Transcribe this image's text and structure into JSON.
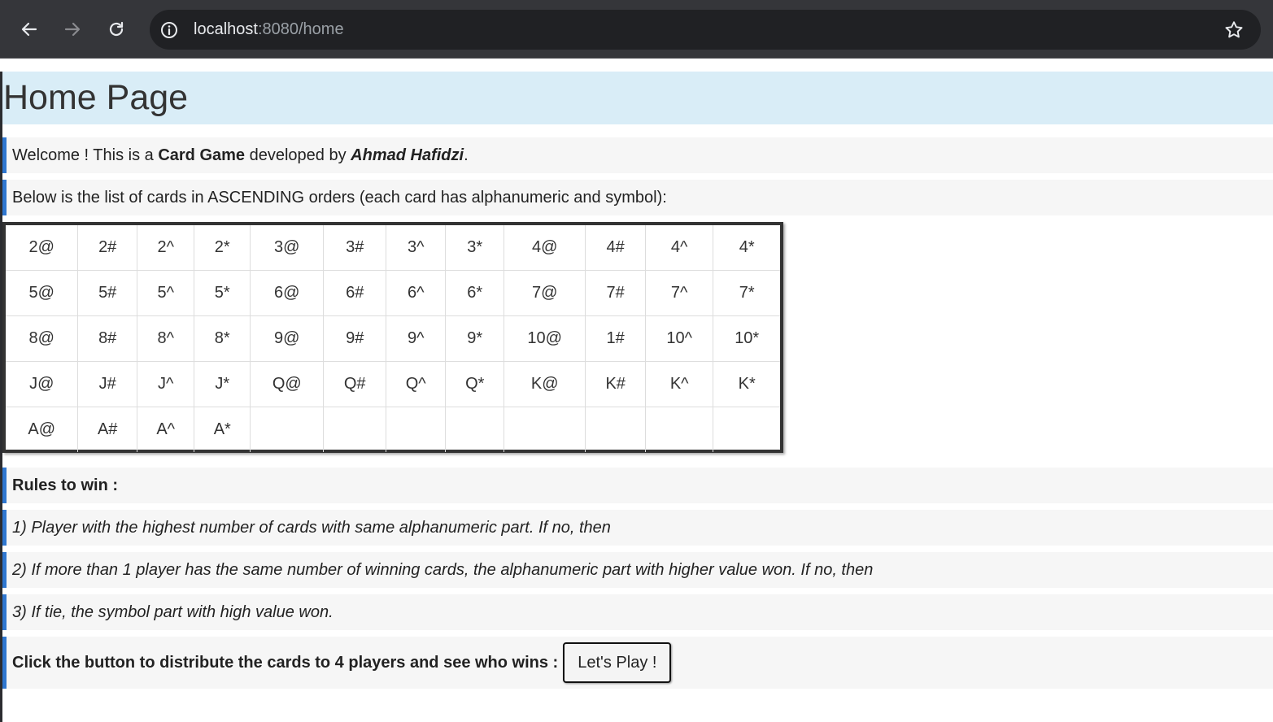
{
  "browser": {
    "url_host": "localhost",
    "url_rest": ":8080/home",
    "icons": [
      "back-icon",
      "forward-icon",
      "reload-icon",
      "site-info-icon",
      "bookmark-star-icon"
    ]
  },
  "page": {
    "title": "Home Page",
    "welcome": {
      "prefix": "Welcome ! This is a ",
      "game": "Card Game",
      "middle": " developed by ",
      "author": "Ahmad Hafidzi",
      "suffix": "."
    },
    "cards_intro": "Below is the list of cards in ASCENDING orders (each card has alphanumeric and symbol):",
    "cards": [
      [
        "2@",
        "2#",
        "2^",
        "2*",
        "3@",
        "3#",
        "3^",
        "3*",
        "4@",
        "4#",
        "4^",
        "4*"
      ],
      [
        "5@",
        "5#",
        "5^",
        "5*",
        "6@",
        "6#",
        "6^",
        "6*",
        "7@",
        "7#",
        "7^",
        "7*"
      ],
      [
        "8@",
        "8#",
        "8^",
        "8*",
        "9@",
        "9#",
        "9^",
        "9*",
        "10@",
        "1#",
        "10^",
        "10*"
      ],
      [
        "J@",
        "J#",
        "J^",
        "J*",
        "Q@",
        "Q#",
        "Q^",
        "Q*",
        "K@",
        "K#",
        "K^",
        "K*"
      ],
      [
        "A@",
        "A#",
        "A^",
        "A*",
        "",
        "",
        "",
        "",
        "",
        "",
        "",
        ""
      ]
    ],
    "rules_title": "Rules to win :",
    "rules": [
      "1) Player with the highest number of cards with same alphanumeric part. If no, then",
      "2) If more than 1 player has the same number of winning cards, the alphanumeric part with higher value won. If no, then",
      "3) If tie, the symbol part with high value won."
    ],
    "cta_text": "Click the button to distribute the cards to 4 players and see who wins :",
    "play_button": "Let's Play !"
  },
  "colors": {
    "banner_bg": "#d9edf7",
    "accent_border": "#2f77d0",
    "chrome_bg": "#35363a"
  }
}
